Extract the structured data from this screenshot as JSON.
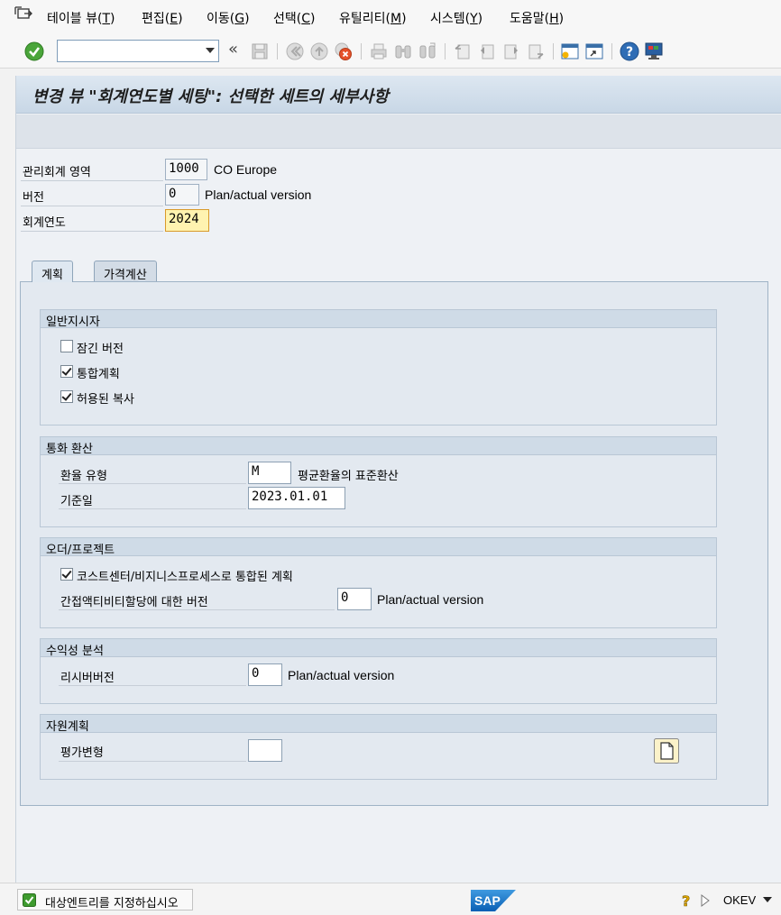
{
  "menu": {
    "items": [
      {
        "label": "테이블 뷰(",
        "key": "T",
        "end": ")"
      },
      {
        "label": "편집(",
        "key": "E",
        "end": ")"
      },
      {
        "label": "이동(",
        "key": "G",
        "end": ")"
      },
      {
        "label": "선택(",
        "key": "C",
        "end": ")"
      },
      {
        "label": "유틸리티(",
        "key": "M",
        "end": ")"
      },
      {
        "label": "시스템(",
        "key": "Y",
        "end": ")"
      },
      {
        "label": "도움말(",
        "key": "H",
        "end": ")"
      }
    ]
  },
  "toolbar": {
    "command_value": "",
    "back_glyph": "«"
  },
  "screen": {
    "title": "변경 뷰 \"회계연도별 세팅\": 선택한 세트의 세부사항"
  },
  "header_fields": {
    "controlling_area": {
      "label": "관리회계 영역",
      "value": "1000",
      "desc": "CO Europe"
    },
    "version": {
      "label": "버전",
      "value": "0",
      "desc": "Plan/actual version"
    },
    "fiscal_year": {
      "label": "회계연도",
      "value": "2024"
    }
  },
  "tabs": [
    {
      "label": "계획",
      "active": true
    },
    {
      "label": "가격계산",
      "active": false
    }
  ],
  "groups": {
    "general": {
      "title": "일반지시자",
      "locked_version": {
        "label": "잠긴 버전",
        "checked": false
      },
      "integrated_planning": {
        "label": "통합계획",
        "checked": true
      },
      "copy_allowed": {
        "label": "허용된 복사",
        "checked": true
      }
    },
    "currency": {
      "title": "통화 환산",
      "rate_type": {
        "label": "환율 유형",
        "value": "M",
        "desc": "평균환율의 표준환산"
      },
      "ref_date": {
        "label": "기준일",
        "value": "2023.01.01"
      }
    },
    "orders": {
      "title": "오더/프로젝트",
      "integrated_cc": {
        "label": "코스트센터/비지니스프로세스로 통합된 계획",
        "checked": true
      },
      "indirect_version": {
        "label": "간접액티비티할당에 대한 버전",
        "value": "0",
        "desc": "Plan/actual version"
      }
    },
    "profitability": {
      "title": "수익성 분석",
      "receiver_version": {
        "label": "리시버버전",
        "value": "0",
        "desc": "Plan/actual version"
      }
    },
    "resources": {
      "title": "자원계획",
      "valuation_variant": {
        "label": "평가변형",
        "value": ""
      }
    }
  },
  "status": {
    "message": "대상엔트리를 지정하십시오",
    "system": "OKEV",
    "sap_logo": "SAP"
  },
  "colors": {
    "title_band": "#c8d7e6",
    "group_head": "#cfdbe7",
    "required_field": "#fff3b0"
  }
}
